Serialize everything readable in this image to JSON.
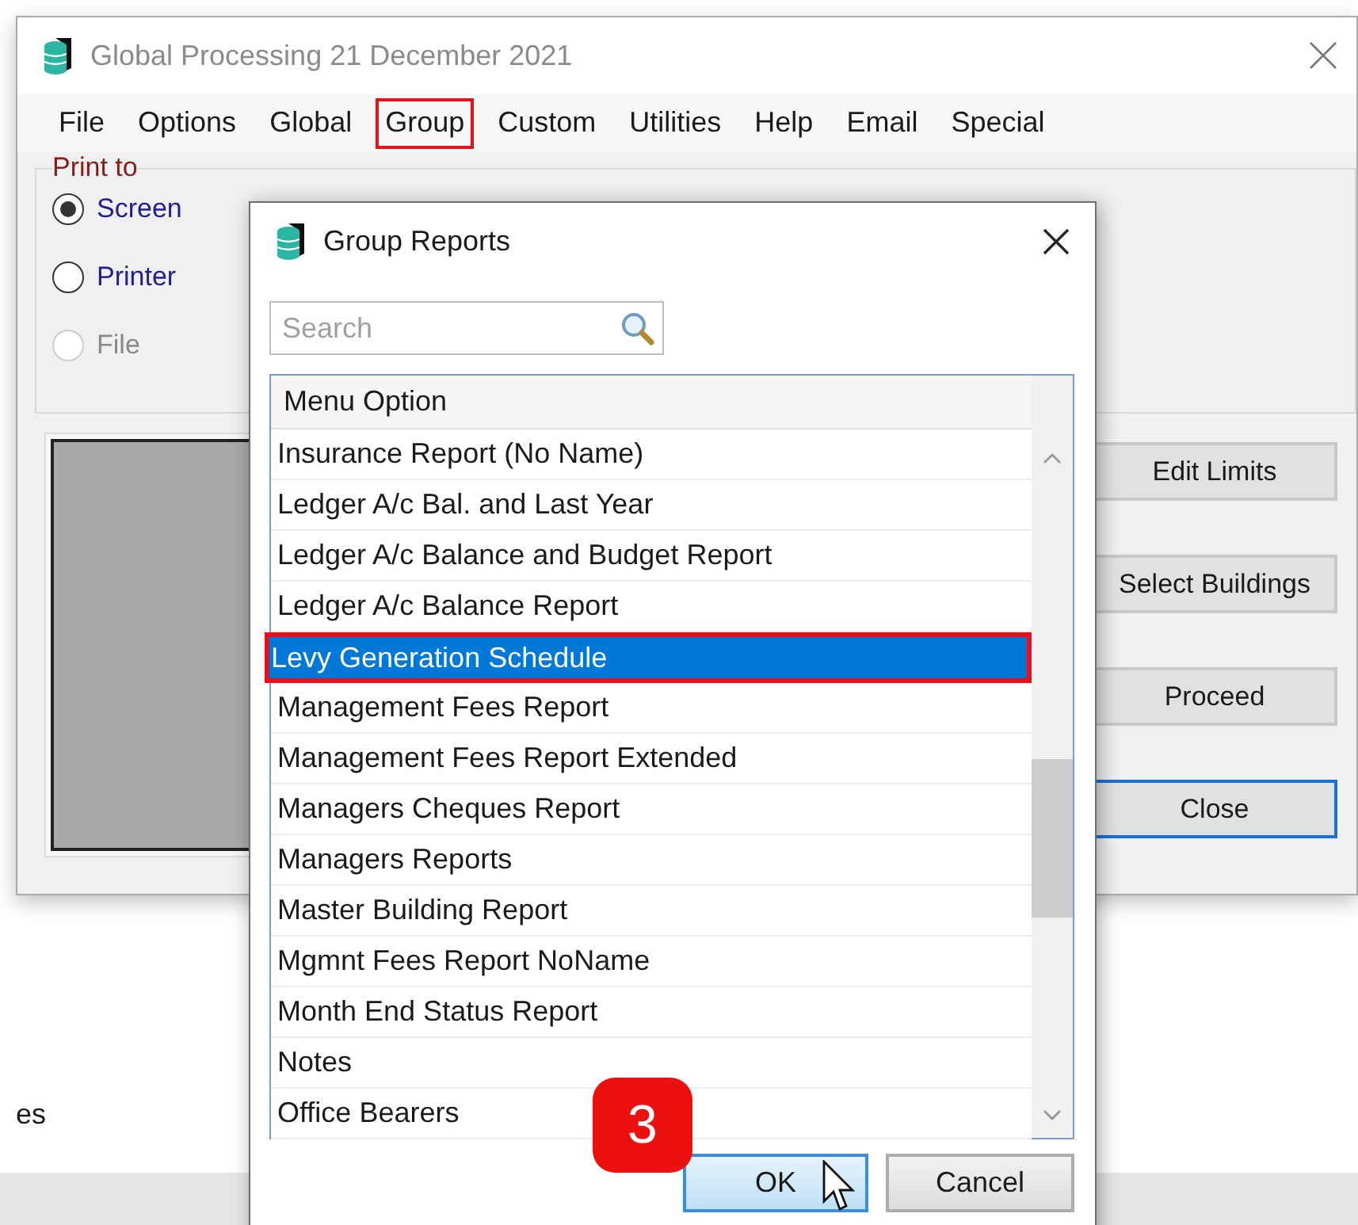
{
  "main_window": {
    "title": "Global Processing 21 December 2021",
    "menu": [
      {
        "label": "File",
        "highlighted": false
      },
      {
        "label": "Options",
        "highlighted": false
      },
      {
        "label": "Global",
        "highlighted": false
      },
      {
        "label": "Group",
        "highlighted": true
      },
      {
        "label": "Custom",
        "highlighted": false
      },
      {
        "label": "Utilities",
        "highlighted": false
      },
      {
        "label": "Help",
        "highlighted": false
      },
      {
        "label": "Email",
        "highlighted": false
      },
      {
        "label": "Special",
        "highlighted": false
      }
    ],
    "print_to": {
      "label": "Print to",
      "options": [
        {
          "label": "Screen",
          "selected": true,
          "disabled": false
        },
        {
          "label": "Printer",
          "selected": false,
          "disabled": false
        },
        {
          "label": "File",
          "selected": false,
          "disabled": true
        }
      ]
    },
    "buttons": [
      {
        "label": "Edit Limits",
        "focused": false
      },
      {
        "label": "Select Buildings",
        "focused": false
      },
      {
        "label": "Proceed",
        "focused": false
      },
      {
        "label": "Close",
        "focused": true
      }
    ]
  },
  "background_text": "es",
  "dialog": {
    "title": "Group Reports",
    "search": {
      "placeholder": "Search"
    },
    "list": {
      "column": "Menu Option",
      "rows": [
        {
          "label": "Insurance Report (No Name)",
          "selected": false,
          "highlighted": false
        },
        {
          "label": "Ledger A/c Bal. and Last Year",
          "selected": false,
          "highlighted": false
        },
        {
          "label": "Ledger A/c Balance and Budget Report",
          "selected": false,
          "highlighted": false
        },
        {
          "label": "Ledger A/c Balance Report",
          "selected": false,
          "highlighted": false
        },
        {
          "label": "Levy Generation Schedule",
          "selected": true,
          "highlighted": true
        },
        {
          "label": "Management Fees Report",
          "selected": false,
          "highlighted": false
        },
        {
          "label": "Management Fees Report Extended",
          "selected": false,
          "highlighted": false
        },
        {
          "label": "Managers Cheques Report",
          "selected": false,
          "highlighted": false
        },
        {
          "label": "Managers Reports",
          "selected": false,
          "highlighted": false
        },
        {
          "label": "Master Building Report",
          "selected": false,
          "highlighted": false
        },
        {
          "label": "Mgmnt Fees Report NoName",
          "selected": false,
          "highlighted": false
        },
        {
          "label": "Month End Status Report",
          "selected": false,
          "highlighted": false
        },
        {
          "label": "Notes",
          "selected": false,
          "highlighted": false
        },
        {
          "label": "Office Bearers",
          "selected": false,
          "highlighted": false
        }
      ]
    },
    "buttons": [
      {
        "label": "OK",
        "kind": "default"
      },
      {
        "label": "Cancel",
        "kind": "normal"
      }
    ]
  },
  "step_badge": "3"
}
